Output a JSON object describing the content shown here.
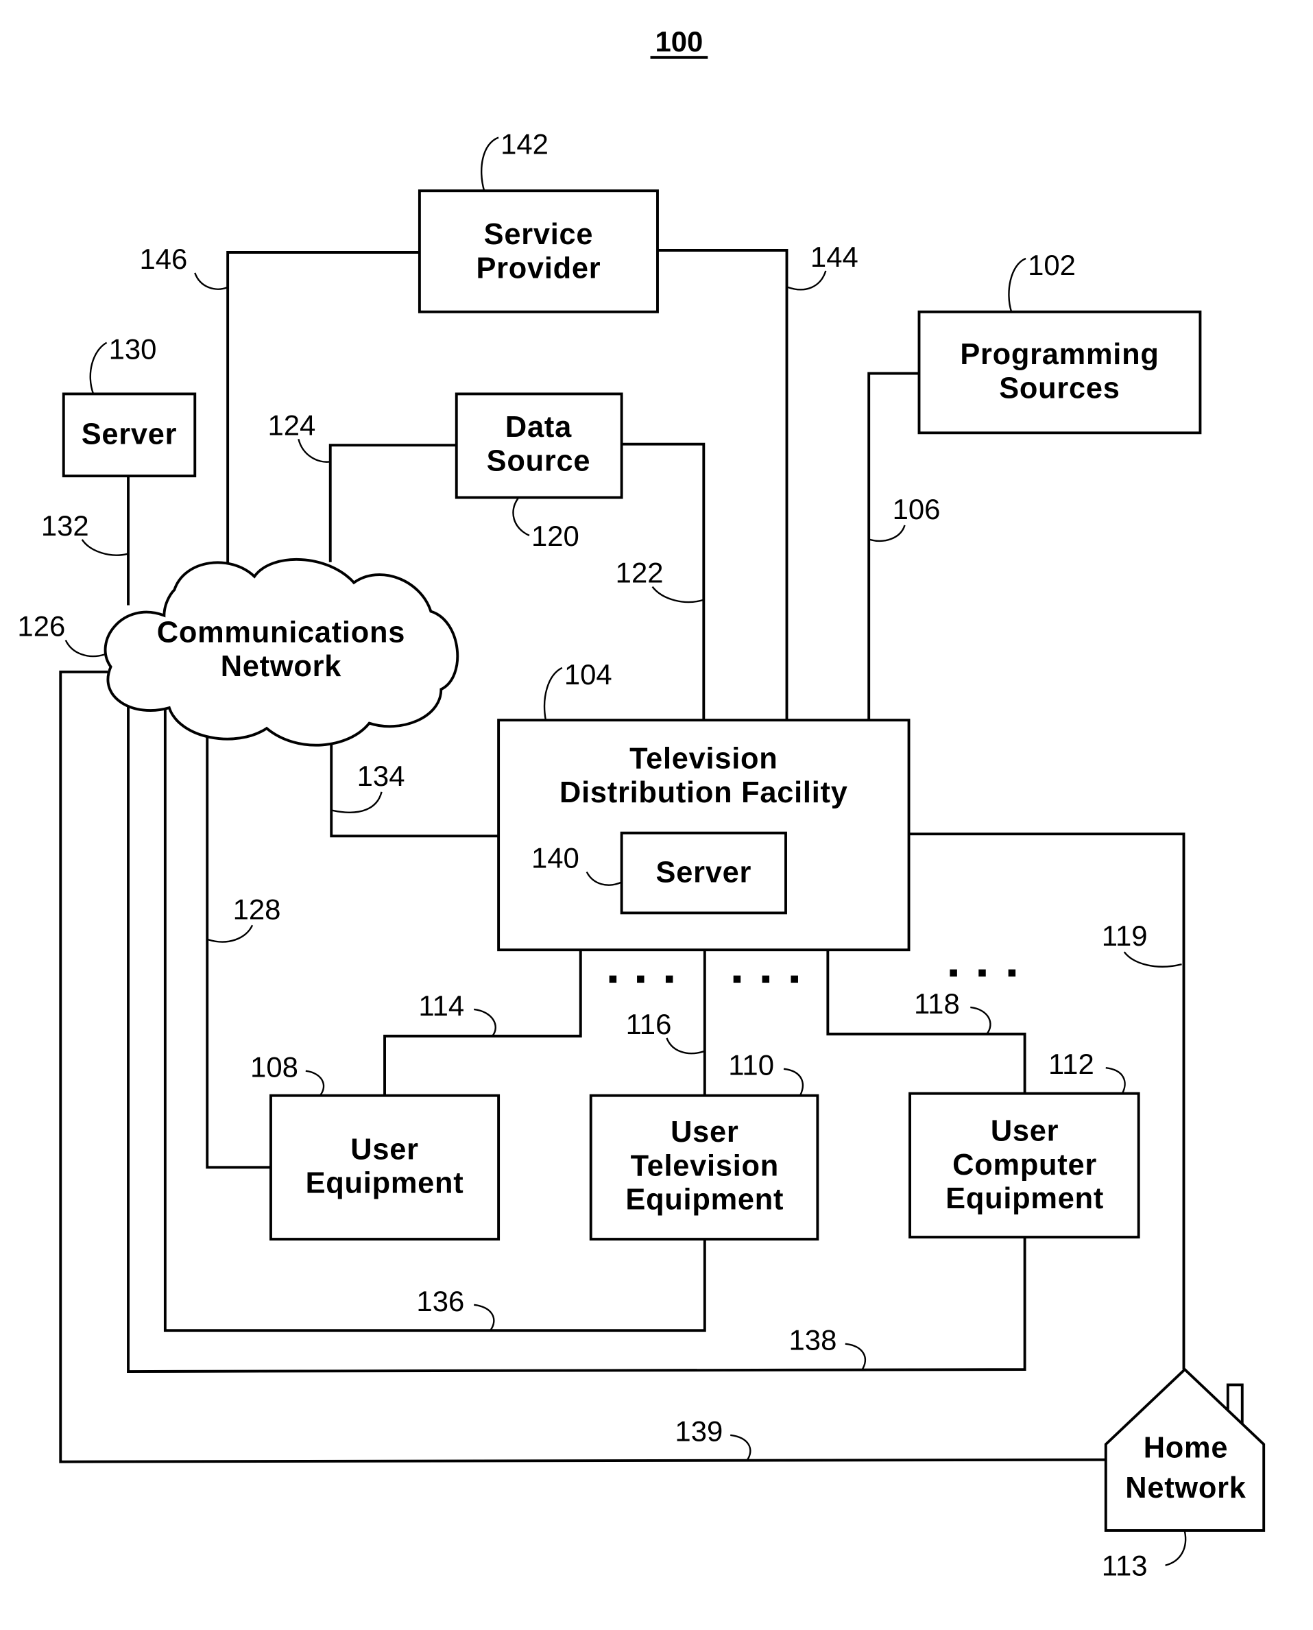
{
  "figure": {
    "number": "100"
  },
  "nodes": {
    "service_provider": {
      "ref": "142",
      "lines": [
        "Service",
        "Provider"
      ]
    },
    "programming_sources": {
      "ref": "102",
      "lines": [
        "Programming",
        "Sources"
      ]
    },
    "server_130": {
      "ref": "130",
      "lines": [
        "Server"
      ]
    },
    "data_source": {
      "ref": "120",
      "lines": [
        "Data",
        "Source"
      ]
    },
    "communications_network": {
      "ref": "126",
      "lines": [
        "Communications",
        "Network"
      ]
    },
    "tv_distribution_facility": {
      "ref": "104",
      "lines": [
        "Television",
        "Distribution Facility"
      ]
    },
    "server_140": {
      "ref": "140",
      "lines": [
        "Server"
      ]
    },
    "user_equipment": {
      "ref": "108",
      "lines": [
        "User",
        "Equipment"
      ]
    },
    "user_tv_equipment": {
      "ref": "110",
      "lines": [
        "User",
        "Television",
        "Equipment"
      ]
    },
    "user_computer_equipment": {
      "ref": "112",
      "lines": [
        "User",
        "Computer",
        "Equipment"
      ]
    },
    "home_network": {
      "ref": "113",
      "lines": [
        "Home",
        "Network"
      ]
    }
  },
  "links": {
    "l146": "146",
    "l144": "144",
    "l124": "124",
    "l122": "122",
    "l106": "106",
    "l132": "132",
    "l134": "134",
    "l128": "128",
    "l114": "114",
    "l116": "116",
    "l118": "118",
    "l119": "119",
    "l136": "136",
    "l138": "138",
    "l139": "139"
  },
  "ellipsis": "..."
}
